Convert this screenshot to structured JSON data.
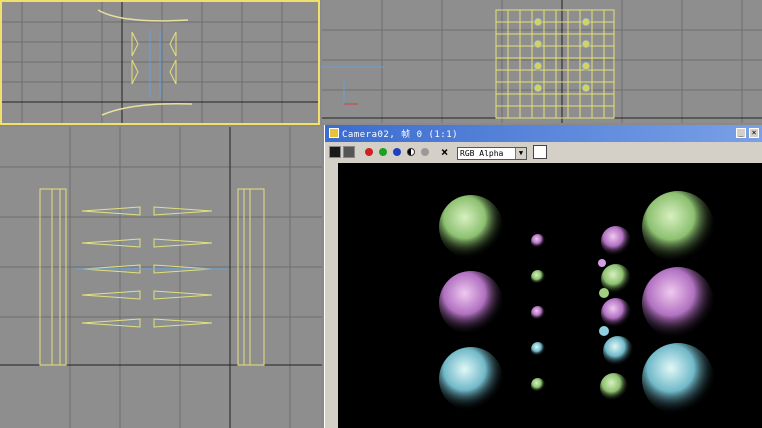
{
  "render_window": {
    "title": "Camera02, 帧 0 (1:1)",
    "channel_select": "RGB Alpha",
    "colors": {
      "title_bar": "#3b6ccf",
      "active_viewport_border": "#f2e06a",
      "viewport_bg": "#8e8e8e",
      "wire": "#e6e07a"
    }
  },
  "icons": {
    "save": "save-icon",
    "clone": "clone-icon",
    "red_channel": "red-channel-icon",
    "green_channel": "green-channel-icon",
    "blue_channel": "blue-channel-icon",
    "mono": "monochrome-icon",
    "alpha": "alpha-channel-icon",
    "clear": "clear-icon",
    "minimize": "minimize-icon",
    "close": "close-icon"
  }
}
